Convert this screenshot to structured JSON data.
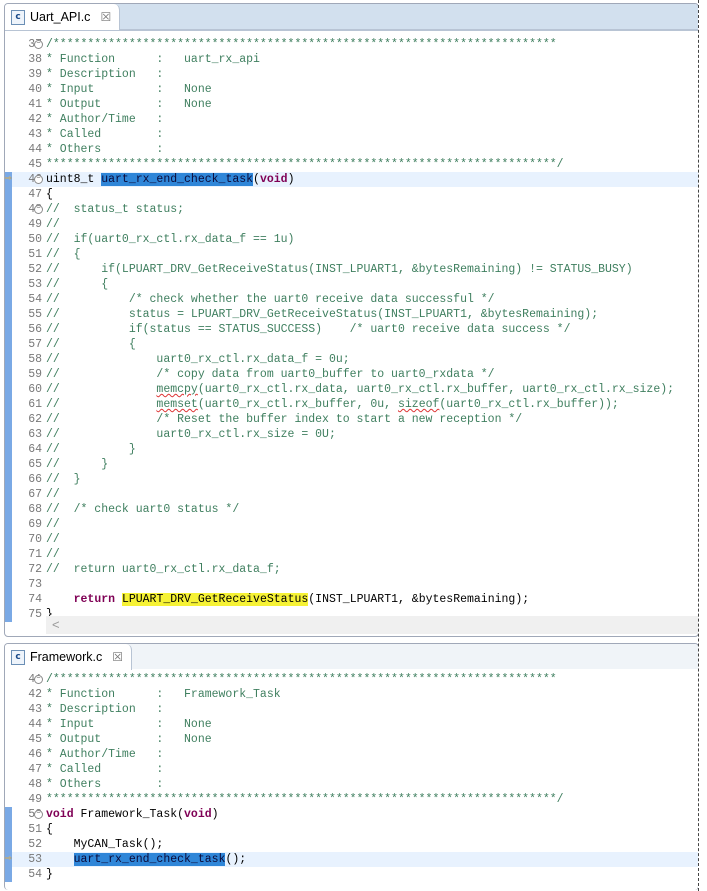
{
  "colors": {
    "comment": "#3f7f5f",
    "keyword": "#7f0055",
    "selection": "#2f86d8",
    "occurrence": "#f6f235",
    "current_line": "#e8f2fe",
    "tabbar": "#d2e0ee"
  },
  "pane1": {
    "tab_label": "Uart_API.c",
    "file_icon": "c-file-icon",
    "close_icon": "close-icon",
    "scroll_left": "<",
    "lines": [
      {
        "n": "37",
        "fold": true,
        "segs": [
          {
            "t": "/*************************************************************************",
            "c": "c"
          }
        ]
      },
      {
        "n": "38",
        "segs": [
          {
            "t": "* Function      :   uart_rx_api",
            "c": "c"
          }
        ]
      },
      {
        "n": "39",
        "segs": [
          {
            "t": "* Description   :",
            "c": "c"
          }
        ]
      },
      {
        "n": "40",
        "segs": [
          {
            "t": "* Input         :   None",
            "c": "c"
          }
        ]
      },
      {
        "n": "41",
        "segs": [
          {
            "t": "* Output        :   None",
            "c": "c"
          }
        ]
      },
      {
        "n": "42",
        "segs": [
          {
            "t": "* Author/Time   :",
            "c": "c"
          }
        ]
      },
      {
        "n": "43",
        "segs": [
          {
            "t": "* Called        :",
            "c": "c"
          }
        ]
      },
      {
        "n": "44",
        "segs": [
          {
            "t": "* Others        :",
            "c": "c"
          }
        ]
      },
      {
        "n": "45",
        "segs": [
          {
            "t": "**************************************************************************/",
            "c": "c"
          }
        ]
      },
      {
        "n": "46",
        "fold": true,
        "arrow": true,
        "cur": true,
        "mark": true,
        "segs": [
          {
            "t": "uint8_t ",
            "c": "p"
          },
          {
            "t": "uart_rx_end_check_task",
            "c": "sel"
          },
          {
            "t": "(",
            "c": "p"
          },
          {
            "t": "void",
            "c": "k"
          },
          {
            "t": ")",
            "c": "p"
          }
        ]
      },
      {
        "n": "47",
        "mark": true,
        "segs": [
          {
            "t": "{",
            "c": "p"
          }
        ]
      },
      {
        "n": "48",
        "fold": true,
        "mark": true,
        "segs": [
          {
            "t": "//  status_t status;",
            "c": "c"
          }
        ]
      },
      {
        "n": "49",
        "mark": true,
        "segs": [
          {
            "t": "//",
            "c": "c"
          }
        ]
      },
      {
        "n": "50",
        "mark": true,
        "segs": [
          {
            "t": "//  if(uart0_rx_ctl.rx_data_f == 1u)",
            "c": "c"
          }
        ]
      },
      {
        "n": "51",
        "mark": true,
        "segs": [
          {
            "t": "//  {",
            "c": "c"
          }
        ]
      },
      {
        "n": "52",
        "mark": true,
        "segs": [
          {
            "t": "//      if(LPUART_DRV_GetReceiveStatus(INST_LPUART1, &bytesRemaining) != STATUS_BUSY)",
            "c": "c"
          }
        ]
      },
      {
        "n": "53",
        "mark": true,
        "segs": [
          {
            "t": "//      {",
            "c": "c"
          }
        ]
      },
      {
        "n": "54",
        "mark": true,
        "segs": [
          {
            "t": "//          /* check whether the uart0 receive data successful */",
            "c": "c"
          }
        ]
      },
      {
        "n": "55",
        "mark": true,
        "segs": [
          {
            "t": "//          status = LPUART_DRV_GetReceiveStatus(INST_LPUART1, &bytesRemaining);",
            "c": "c"
          }
        ]
      },
      {
        "n": "56",
        "mark": true,
        "segs": [
          {
            "t": "//          if(status == STATUS_SUCCESS)    /* uart0 receive data success */",
            "c": "c"
          }
        ]
      },
      {
        "n": "57",
        "mark": true,
        "segs": [
          {
            "t": "//          {",
            "c": "c"
          }
        ]
      },
      {
        "n": "58",
        "mark": true,
        "segs": [
          {
            "t": "//              uart0_rx_ctl.rx_data_f = 0u;",
            "c": "c"
          }
        ]
      },
      {
        "n": "59",
        "mark": true,
        "segs": [
          {
            "t": "//              /* copy data from uart0_buffer to uart0_rxdata */",
            "c": "c"
          }
        ]
      },
      {
        "n": "60",
        "mark": true,
        "segs": [
          {
            "t": "//              ",
            "c": "c"
          },
          {
            "t": "memcpy",
            "c": "w"
          },
          {
            "t": "(uart0_rx_ctl.rx_data, uart0_rx_ctl.rx_buffer, uart0_rx_ctl.rx_size);",
            "c": "c"
          }
        ]
      },
      {
        "n": "61",
        "mark": true,
        "segs": [
          {
            "t": "//              ",
            "c": "c"
          },
          {
            "t": "memset",
            "c": "w"
          },
          {
            "t": "(uart0_rx_ctl.rx_buffer, 0u, ",
            "c": "c"
          },
          {
            "t": "sizeof",
            "c": "w"
          },
          {
            "t": "(uart0_rx_ctl.rx_buffer));",
            "c": "c"
          }
        ]
      },
      {
        "n": "62",
        "mark": true,
        "segs": [
          {
            "t": "//              /* Reset the buffer index to start a new reception */",
            "c": "c"
          }
        ]
      },
      {
        "n": "63",
        "mark": true,
        "segs": [
          {
            "t": "//              uart0_rx_ctl.rx_size = 0U;",
            "c": "c"
          }
        ]
      },
      {
        "n": "64",
        "mark": true,
        "segs": [
          {
            "t": "//          }",
            "c": "c"
          }
        ]
      },
      {
        "n": "65",
        "mark": true,
        "segs": [
          {
            "t": "//      }",
            "c": "c"
          }
        ]
      },
      {
        "n": "66",
        "mark": true,
        "segs": [
          {
            "t": "//  }",
            "c": "c"
          }
        ]
      },
      {
        "n": "67",
        "mark": true,
        "segs": [
          {
            "t": "//",
            "c": "c"
          }
        ]
      },
      {
        "n": "68",
        "mark": true,
        "segs": [
          {
            "t": "//  /* check uart0 status */",
            "c": "c"
          }
        ]
      },
      {
        "n": "69",
        "mark": true,
        "segs": [
          {
            "t": "//",
            "c": "c"
          }
        ]
      },
      {
        "n": "70",
        "mark": true,
        "segs": [
          {
            "t": "//",
            "c": "c"
          }
        ]
      },
      {
        "n": "71",
        "mark": true,
        "segs": [
          {
            "t": "//",
            "c": "c"
          }
        ]
      },
      {
        "n": "72",
        "mark": true,
        "segs": [
          {
            "t": "//  return uart0_rx_ctl.rx_data_f;",
            "c": "c"
          }
        ]
      },
      {
        "n": "73",
        "mark": true,
        "segs": []
      },
      {
        "n": "74",
        "mark": true,
        "segs": [
          {
            "t": "    ",
            "c": "p"
          },
          {
            "t": "return",
            "c": "k"
          },
          {
            "t": " ",
            "c": "p"
          },
          {
            "t": "LPUART_DRV_GetReceiveStatus",
            "c": "occ"
          },
          {
            "t": "(INST_LPUART1, &bytesRemaining);",
            "c": "p"
          }
        ]
      },
      {
        "n": "75",
        "mark": true,
        "segs": [
          {
            "t": "}",
            "c": "p"
          }
        ]
      }
    ]
  },
  "pane2": {
    "tab_label": "Framework.c",
    "file_icon": "c-file-icon",
    "close_icon": "close-icon",
    "lines": [
      {
        "n": "41",
        "fold": true,
        "segs": [
          {
            "t": "/*************************************************************************",
            "c": "c"
          }
        ]
      },
      {
        "n": "42",
        "segs": [
          {
            "t": "* Function      :   Framework_Task",
            "c": "c"
          }
        ]
      },
      {
        "n": "43",
        "segs": [
          {
            "t": "* Description   :",
            "c": "c"
          }
        ]
      },
      {
        "n": "44",
        "segs": [
          {
            "t": "* Input         :   None",
            "c": "c"
          }
        ]
      },
      {
        "n": "45",
        "segs": [
          {
            "t": "* Output        :   None",
            "c": "c"
          }
        ]
      },
      {
        "n": "46",
        "segs": [
          {
            "t": "* Author/Time   :",
            "c": "c"
          }
        ]
      },
      {
        "n": "47",
        "segs": [
          {
            "t": "* Called        :",
            "c": "c"
          }
        ]
      },
      {
        "n": "48",
        "segs": [
          {
            "t": "* Others        :",
            "c": "c"
          }
        ]
      },
      {
        "n": "49",
        "segs": [
          {
            "t": "**************************************************************************/",
            "c": "c"
          }
        ]
      },
      {
        "n": "50",
        "fold": true,
        "mark": true,
        "segs": [
          {
            "t": "void",
            "c": "k"
          },
          {
            "t": " Framework_Task(",
            "c": "p"
          },
          {
            "t": "void",
            "c": "k"
          },
          {
            "t": ")",
            "c": "p"
          }
        ]
      },
      {
        "n": "51",
        "mark": true,
        "segs": [
          {
            "t": "{",
            "c": "p"
          }
        ]
      },
      {
        "n": "52",
        "mark": true,
        "segs": [
          {
            "t": "    MyCAN_Task();",
            "c": "p"
          }
        ]
      },
      {
        "n": "53",
        "mark": true,
        "arrow": true,
        "cur": true,
        "segs": [
          {
            "t": "    ",
            "c": "p"
          },
          {
            "t": "uart_rx_end_check_task",
            "c": "sel"
          },
          {
            "t": "();",
            "c": "p"
          }
        ]
      },
      {
        "n": "54",
        "mark": true,
        "segs": [
          {
            "t": "}",
            "c": "p"
          }
        ]
      }
    ]
  }
}
